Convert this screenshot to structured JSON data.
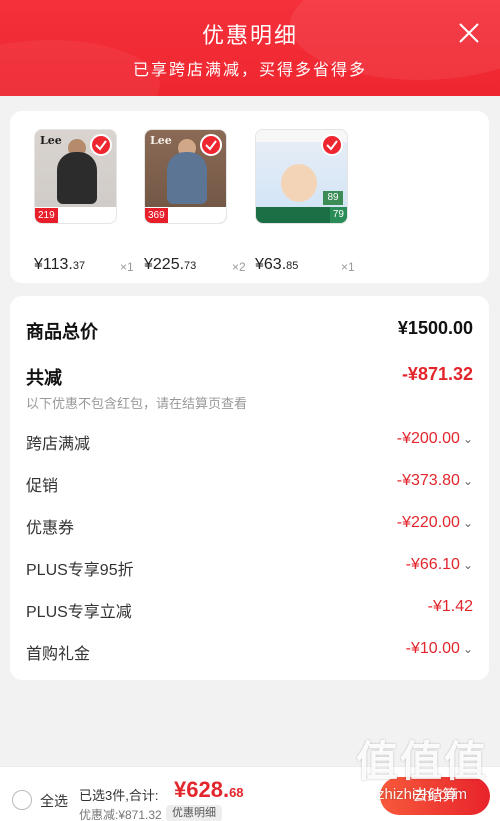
{
  "header": {
    "title": "优惠明细",
    "subtitle": "已享跨店满减，买得多省得多"
  },
  "products": [
    {
      "brand": "Lee",
      "tag_price": "219",
      "price_main": "¥113.",
      "price_cents": "37",
      "qty": "×1",
      "checked": true
    },
    {
      "brand": "Lee",
      "tag_price": "369",
      "price_main": "¥225.",
      "price_cents": "73",
      "qty": "×2",
      "checked": true
    },
    {
      "brand": "",
      "tag_price": "79",
      "extra_badge": "89",
      "price_main": "¥63.",
      "price_cents": "85",
      "qty": "×1",
      "checked": true
    }
  ],
  "details": {
    "total_label": "商品总价",
    "total_value": "¥1500.00",
    "reduce_label": "共减",
    "reduce_value": "-¥871.32",
    "note": "以下优惠不包含红包，请在结算页查看",
    "items": [
      {
        "label": "跨店满减",
        "value": "-¥200.00",
        "caret": true
      },
      {
        "label": "促销",
        "value": "-¥373.80",
        "caret": true
      },
      {
        "label": "优惠券",
        "value": "-¥220.00",
        "caret": true
      },
      {
        "label": "PLUS专享95折",
        "value": "-¥66.10",
        "caret": true
      },
      {
        "label": "PLUS专享立减",
        "value": "-¥1.42",
        "caret": false
      },
      {
        "label": "首购礼金",
        "value": "-¥10.00",
        "caret": true
      }
    ],
    "caret_symbol": "⌄"
  },
  "bottom_bar": {
    "select_all": "全选",
    "selected_summary": "已选3件,合计:",
    "total_main": "¥628.",
    "total_cents": "68",
    "reduced_text": "优惠减:¥871.32",
    "detail_chip": "优惠明细",
    "checkout_label": "去结算"
  },
  "watermark": {
    "logo": "值值值",
    "domain": "zhizhizhi.com"
  }
}
